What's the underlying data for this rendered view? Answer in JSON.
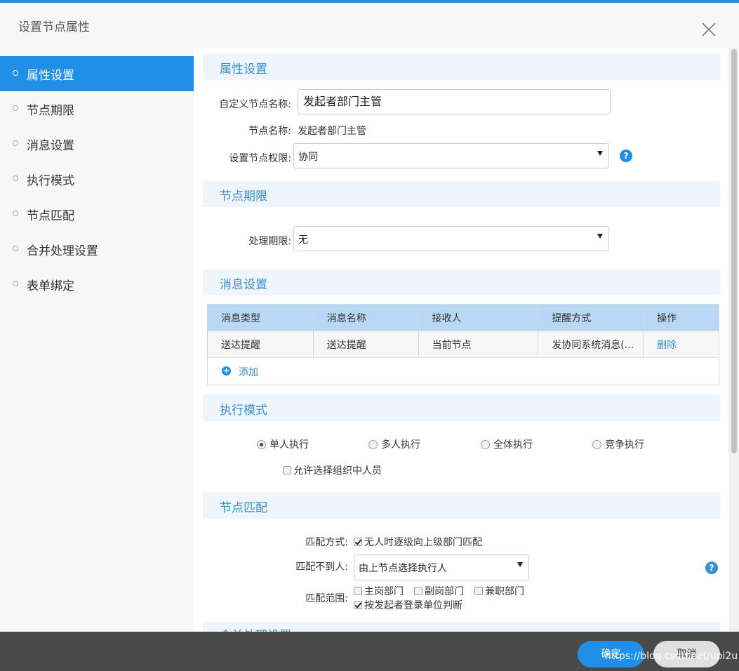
{
  "dialog": {
    "title": "设置节点属性"
  },
  "sidebar": {
    "items": [
      {
        "label": "属性设置",
        "active": true
      },
      {
        "label": "节点期限",
        "active": false
      },
      {
        "label": "消息设置",
        "active": false
      },
      {
        "label": "执行模式",
        "active": false
      },
      {
        "label": "节点匹配",
        "active": false
      },
      {
        "label": "合并处理设置",
        "active": false
      },
      {
        "label": "表单绑定",
        "active": false
      }
    ]
  },
  "attr": {
    "heading": "属性设置",
    "custom_name_label": "自定义节点名称:",
    "custom_name_value": "发起者部门主管",
    "node_name_label": "节点名称:",
    "node_name_value": "发起者部门主管",
    "permission_label": "设置节点权限:",
    "permission_value": "协同",
    "help": "?"
  },
  "deadline": {
    "heading": "节点期限",
    "label": "处理期限:",
    "value": "无"
  },
  "message": {
    "heading": "消息设置",
    "columns": [
      "消息类型",
      "消息名称",
      "接收人",
      "提醒方式",
      "操作"
    ],
    "rows": [
      {
        "type": "送达提醒",
        "name": "送达提醒",
        "receiver": "当前节点",
        "method": "发协同系统消息(...",
        "action": "删除"
      }
    ],
    "add_label": "添加",
    "add_icon": "plus-circle-icon"
  },
  "exec": {
    "heading": "执行模式",
    "options": [
      {
        "label": "单人执行",
        "checked": true
      },
      {
        "label": "多人执行",
        "checked": false
      },
      {
        "label": "全体执行",
        "checked": false
      },
      {
        "label": "竞争执行",
        "checked": false
      }
    ],
    "allow_label": "允许选择组织中人员",
    "allow_checked": false
  },
  "match": {
    "heading": "节点匹配",
    "mode_label": "匹配方式:",
    "mode_option": "无人时逐级向上级部门匹配",
    "mode_checked": true,
    "fallback_label": "匹配不到人:",
    "fallback_value": "由上节点选择执行人",
    "range_label": "匹配范围:",
    "range_options": [
      {
        "label": "主岗部门",
        "checked": false
      },
      {
        "label": "副岗部门",
        "checked": false
      },
      {
        "label": "兼职部门",
        "checked": false
      }
    ],
    "login_unit_label": "按发起者登录单位判断",
    "login_unit_checked": true,
    "help": "?"
  },
  "merge": {
    "heading": "合并处理设置"
  },
  "footer": {
    "ok_label": "确定",
    "cancel_label": "取消",
    "watermark": "https://blog.csdn.net/upi2u"
  },
  "colors": {
    "accent": "#1f8fe8",
    "section_text": "#3a8fd0",
    "footer_bg": "#4a4a4a"
  }
}
